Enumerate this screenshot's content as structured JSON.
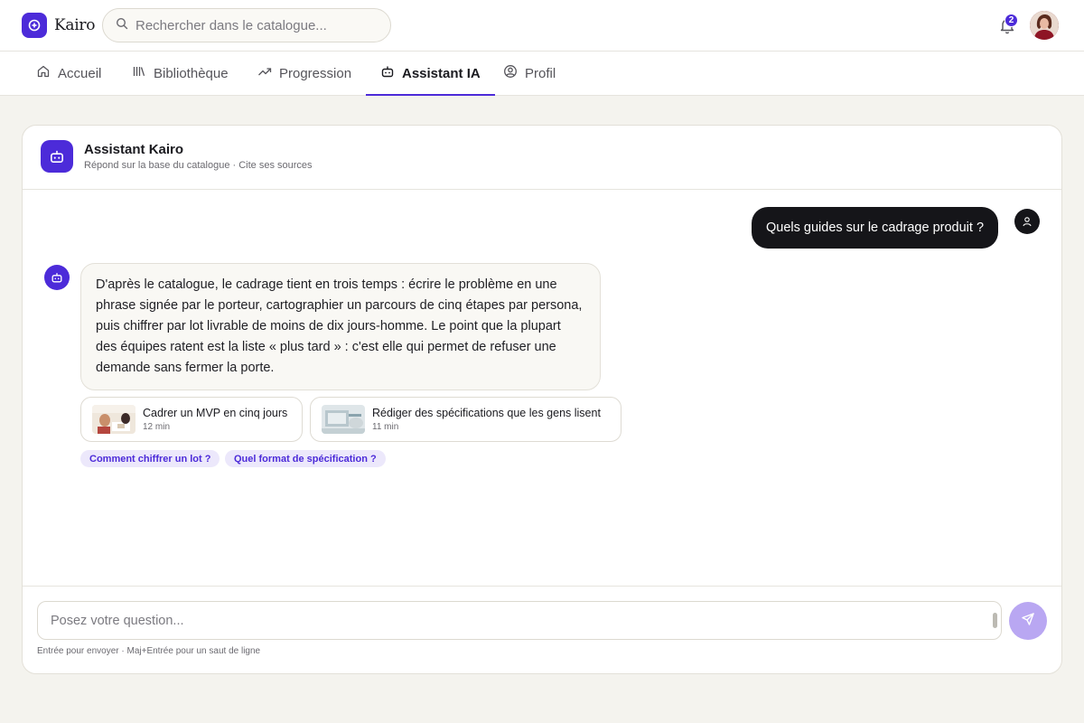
{
  "app": {
    "name": "Kairo"
  },
  "search": {
    "placeholder": "Rechercher dans le catalogue..."
  },
  "notifications": {
    "count": "2"
  },
  "nav": {
    "tabs": [
      {
        "label": "Accueil",
        "icon": "home-icon",
        "active": false
      },
      {
        "label": "Bibliothèque",
        "icon": "library-icon",
        "active": false
      },
      {
        "label": "Progression",
        "icon": "trending-up-icon",
        "active": false
      },
      {
        "label": "Assistant IA",
        "icon": "bot-icon",
        "active": true
      },
      {
        "label": "Profil",
        "icon": "user-circle-icon",
        "active": false
      }
    ]
  },
  "assistant": {
    "title": "Assistant Kairo",
    "subtitle": "Répond sur la base du catalogue · Cite ses sources"
  },
  "messages": {
    "user": "Quels guides sur le cadrage produit ?",
    "bot": "D'après le catalogue, le cadrage tient en trois temps : écrire le problème en une phrase signée par le porteur, cartographier un parcours de cinq étapes par persona, puis chiffrer par lot livrable de moins de dix jours-homme. Le point que la plupart des équipes ratent est la liste « plus tard » : c'est elle qui permet de refuser une demande sans fermer la porte."
  },
  "sources": [
    {
      "title": "Cadrer un MVP en cinq jours",
      "duration": "12 min"
    },
    {
      "title": "Rédiger des spécifications que les gens lisent",
      "duration": "11 min"
    }
  ],
  "suggestions": [
    "Comment chiffrer un lot ?",
    "Quel format de spécification ?"
  ],
  "composer": {
    "placeholder": "Posez votre question...",
    "hint": "Entrée pour envoyer · Maj+Entrée pour un saut de ligne"
  },
  "colors": {
    "accent": "#4c2bd9",
    "background": "#f4f3ee",
    "user_bubble": "#151519",
    "send_disabled": "#b9a7f2"
  }
}
